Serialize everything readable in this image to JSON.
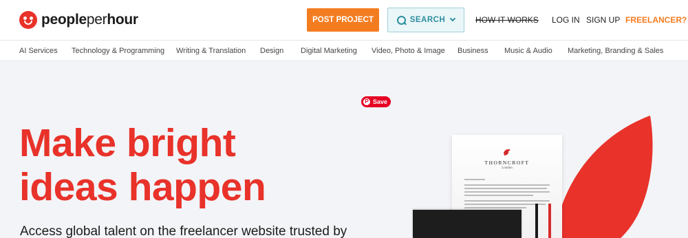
{
  "brand": {
    "part1": "people",
    "part2": "per",
    "part3": "hour"
  },
  "header": {
    "post_project": "POST PROJECT",
    "search": "SEARCH",
    "how_it_works": "HOW IT WORKS",
    "log_in": "LOG IN",
    "sign_up": "SIGN UP",
    "freelancer": "FREELANCER?"
  },
  "categories": [
    "AI Services",
    "Technology & Programming",
    "Writing & Translation",
    "Design",
    "Digital Marketing",
    "Video, Photo & Image",
    "Business",
    "Music & Audio",
    "Marketing, Branding & Sales"
  ],
  "hero": {
    "save": "Save",
    "headline_line1": "Make bright",
    "headline_line2": "ideas happen",
    "subline": "Access global talent on the freelancer website trusted by"
  },
  "illustration": {
    "letter_brand": "THORNCROFT",
    "letter_sub": "London"
  },
  "colors": {
    "brand_red": "#e8322a",
    "accent_orange": "#f47c20",
    "search_teal": "#2d8ea0",
    "pinterest_red": "#e60023"
  }
}
